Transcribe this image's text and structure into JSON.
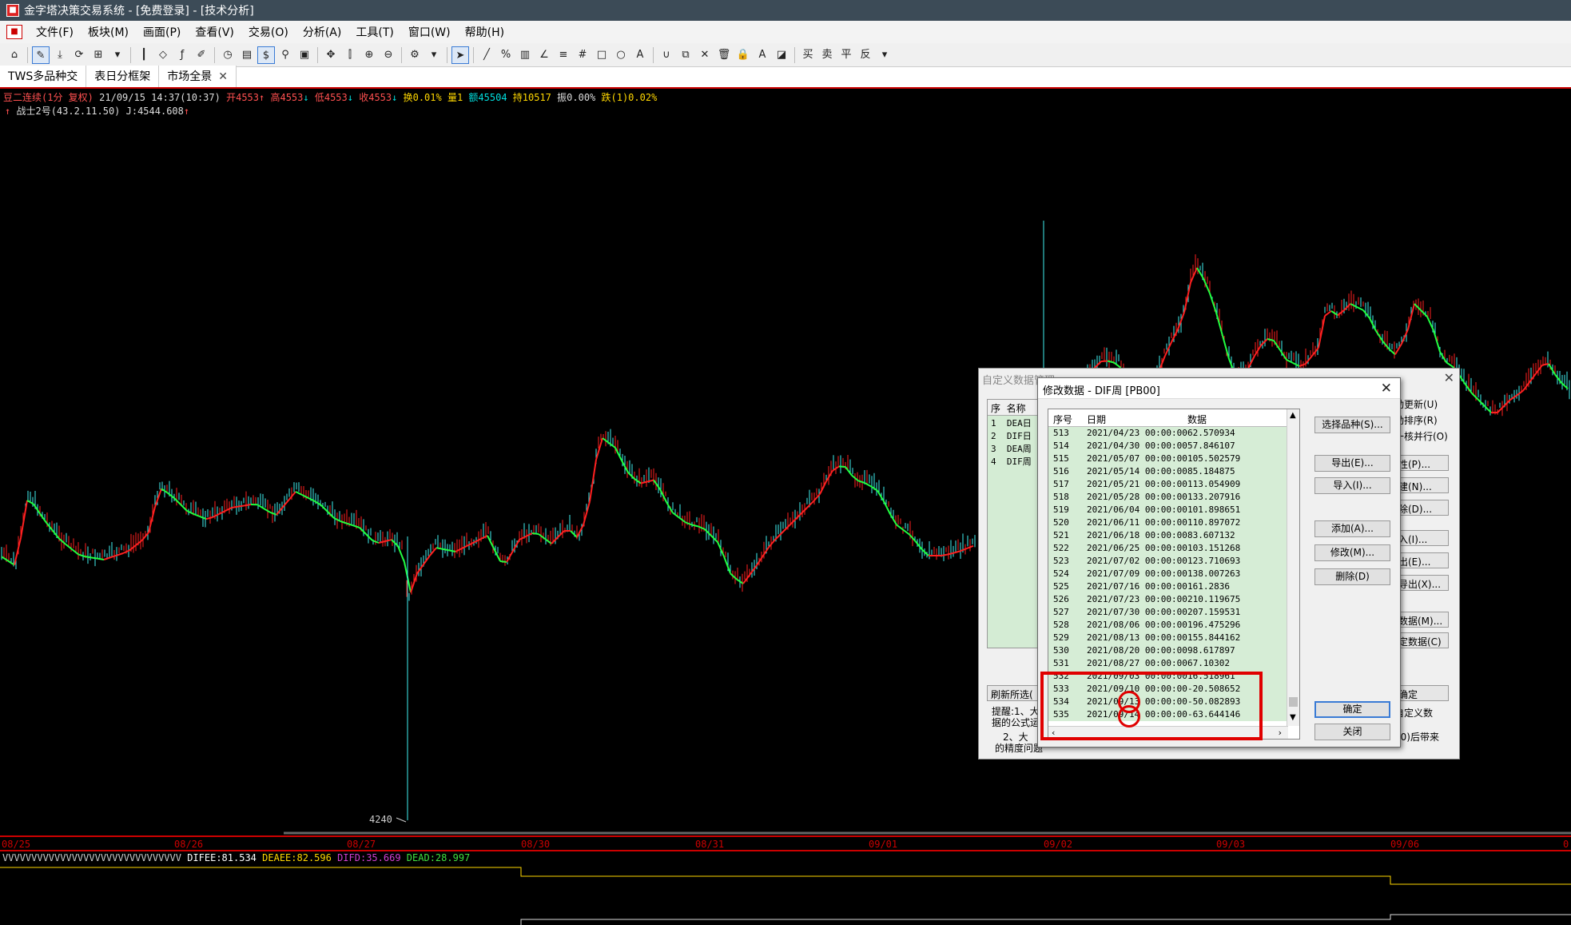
{
  "window": {
    "title": "金字塔决策交易系统 - [免费登录] - [技术分析]"
  },
  "menu": [
    "文件(F)",
    "板块(M)",
    "画面(P)",
    "查看(V)",
    "交易(O)",
    "分析(A)",
    "工具(T)",
    "窗口(W)",
    "帮助(H)"
  ],
  "tabs": [
    {
      "label": "TWS多品种交"
    },
    {
      "label": "表日分框架"
    },
    {
      "label": "市场全景",
      "closable": true,
      "close_glyph": "✕"
    }
  ],
  "quote": {
    "symbol": "豆二连续(1分 复权)",
    "datetime": "21/09/15 14:37(10:37)",
    "open": "开4553",
    "high": "高4553",
    "low": "低4553",
    "close": "收4553",
    "change_pct": "换0.01%",
    "volume": "量1",
    "amount": "额45504",
    "hold": "持10517",
    "amp": "振0.00%",
    "fall": "跌(1)0.02%",
    "arrow_up": "↑",
    "arrow_down": "↓"
  },
  "indicator_line": {
    "name": "战士2号(43.2.11.50)",
    "value": "J:4544.608",
    "arrow": "↑"
  },
  "price_low_label": "4240",
  "x_axis_dates": [
    "08/25",
    "08/26",
    "08/27",
    "08/30",
    "08/31",
    "09/01",
    "09/02",
    "09/03",
    "09/06",
    "0"
  ],
  "sub_indicator": {
    "prefix": "VVVVVVVVVVVVVVVVVVVVVVVVVVVVVVV",
    "difee": "DIFEE:81.534",
    "deaee": "DEAEE:82.596",
    "difd": "DIFD:35.669",
    "dead": "DEAD:28.997"
  },
  "back_dialog": {
    "title": "自定义数据管理",
    "list_headers": [
      "序",
      "名称"
    ],
    "list_rows": [
      {
        "n": "1",
        "name": "DEA日"
      },
      {
        "n": "2",
        "name": "DIF日"
      },
      {
        "n": "3",
        "name": "DEA周"
      },
      {
        "n": "4",
        "name": "DIF周"
      }
    ],
    "right_texts": [
      "动更新(U)",
      "动排序(R)",
      "一核并行(O)"
    ],
    "right_buttons": [
      "性(P)...",
      "建(N)...",
      "除(D)...",
      "入(I)...",
      "出(E)...",
      "导出(X)...",
      "数据(M)...",
      "定数据(C)"
    ],
    "refresh_btn": "刷新所选(",
    "ok_btn": "确定",
    "custom_text": "自定义数",
    "tip1": "提醒:1、大",
    "tip2": "据的公式运",
    "tip3": "2、大",
    "tip4": "的精度问题",
    "tail_text": "00)后带来"
  },
  "dialog": {
    "title": "修改数据 - DIF周 [PB00]",
    "close_glyph": "✕",
    "columns": [
      "序号",
      "日期",
      "数据"
    ],
    "rows": [
      {
        "n": "513",
        "date": "2021/04/23 00:00:00",
        "val": "62.570934"
      },
      {
        "n": "514",
        "date": "2021/04/30 00:00:00",
        "val": "57.846107"
      },
      {
        "n": "515",
        "date": "2021/05/07 00:00:00",
        "val": "105.502579"
      },
      {
        "n": "516",
        "date": "2021/05/14 00:00:00",
        "val": "85.184875"
      },
      {
        "n": "517",
        "date": "2021/05/21 00:00:00",
        "val": "113.054909"
      },
      {
        "n": "518",
        "date": "2021/05/28 00:00:00",
        "val": "133.207916"
      },
      {
        "n": "519",
        "date": "2021/06/04 00:00:00",
        "val": "101.898651"
      },
      {
        "n": "520",
        "date": "2021/06/11 00:00:00",
        "val": "110.897072"
      },
      {
        "n": "521",
        "date": "2021/06/18 00:00:00",
        "val": "83.607132"
      },
      {
        "n": "522",
        "date": "2021/06/25 00:00:00",
        "val": "103.151268"
      },
      {
        "n": "523",
        "date": "2021/07/02 00:00:00",
        "val": "123.710693"
      },
      {
        "n": "524",
        "date": "2021/07/09 00:00:00",
        "val": "138.007263"
      },
      {
        "n": "525",
        "date": "2021/07/16 00:00:00",
        "val": "161.2836"
      },
      {
        "n": "526",
        "date": "2021/07/23 00:00:00",
        "val": "210.119675"
      },
      {
        "n": "527",
        "date": "2021/07/30 00:00:00",
        "val": "207.159531"
      },
      {
        "n": "528",
        "date": "2021/08/06 00:00:00",
        "val": "196.475296"
      },
      {
        "n": "529",
        "date": "2021/08/13 00:00:00",
        "val": "155.844162"
      },
      {
        "n": "530",
        "date": "2021/08/20 00:00:00",
        "val": "98.617897"
      },
      {
        "n": "531",
        "date": "2021/08/27 00:00:00",
        "val": "67.10302"
      },
      {
        "n": "532",
        "date": "2021/09/03 00:00:00",
        "val": "16.518961"
      },
      {
        "n": "533",
        "date": "2021/09/10 00:00:00",
        "val": "-20.508652"
      },
      {
        "n": "534",
        "date": "2021/09/13 00:00:00",
        "val": "-50.082893"
      },
      {
        "n": "535",
        "date": "2021/09/14 00:00:00",
        "val": "-63.644146"
      }
    ],
    "buttons": {
      "select": "选择品种(S)...",
      "export": "导出(E)...",
      "import": "导入(I)...",
      "add": "添加(A)...",
      "modify": "修改(M)...",
      "delete": "删除(D)",
      "ok": "确定",
      "close": "关闭"
    }
  },
  "colors": {
    "up": "#ff2020",
    "down": "#40f0f0",
    "ma": "#20ff40",
    "highlight": "#e00000"
  }
}
